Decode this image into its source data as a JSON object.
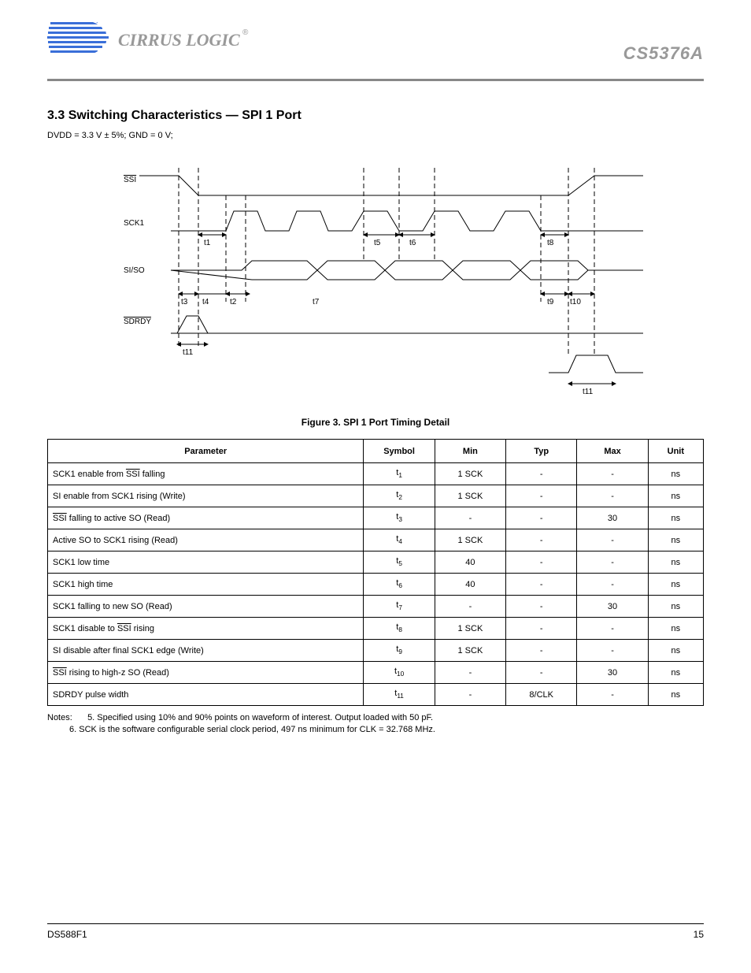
{
  "header": {
    "brand": "CIRRUS LOGIC",
    "part": "CS5376A"
  },
  "sections": {
    "switching": {
      "number_title": "3.3  Switching Characteristics — SPI 1 Port",
      "condition": "DVDD = 3.3 V ± 5%; GND = 0 V;",
      "fig_caption": "Figure 3.  SPI 1 Port Timing Detail"
    }
  },
  "diagram": {
    "signals": [
      "SSI",
      "SCK1",
      "SI/SO",
      "SDRDY"
    ],
    "timings": {
      "t1": "t1",
      "t2": "t2",
      "t3": "t3",
      "t4": "t4",
      "t5": "t5",
      "t6": "t6",
      "t7": "t7",
      "t8": "t8",
      "t9": "t9",
      "t10": "t10",
      "t11": "t11"
    }
  },
  "table": {
    "headers": [
      "Parameter",
      "Symbol",
      "Min",
      "Typ",
      "Max",
      "Unit"
    ],
    "rows": [
      {
        "p_html": "SCK1 enable from <span class='over'>SSI</span> falling",
        "sym": "t<sub>1</sub>",
        "min": "1 SCK",
        "typ": "-",
        "max": "-",
        "unit": "ns"
      },
      {
        "p_html": "SI enable from SCK1 rising (Write)",
        "sym": "t<sub>2</sub>",
        "min": "1 SCK",
        "typ": "-",
        "max": "-",
        "unit": "ns"
      },
      {
        "p_html": "<span class='over'>SSI</span> falling to active SO (Read)",
        "sym": "t<sub>3</sub>",
        "min": "-",
        "typ": "-",
        "max": "30",
        "unit": "ns"
      },
      {
        "p_html": "Active SO to SCK1 rising (Read)",
        "sym": "t<sub>4</sub>",
        "min": "1 SCK",
        "typ": "-",
        "max": "-",
        "unit": "ns"
      },
      {
        "p_html": "SCK1 low time",
        "sym": "t<sub>5</sub>",
        "min": "40",
        "typ": "-",
        "max": "-",
        "unit": "ns"
      },
      {
        "p_html": "SCK1 high time",
        "sym": "t<sub>6</sub>",
        "min": "40",
        "typ": "-",
        "max": "-",
        "unit": "ns"
      },
      {
        "p_html": "SCK1 falling to new SO (Read)",
        "sym": "t<sub>7</sub>",
        "min": "-",
        "typ": "-",
        "max": "30",
        "unit": "ns"
      },
      {
        "p_html": "SCK1 disable to <span class='over'>SSI</span> rising",
        "sym": "t<sub>8</sub>",
        "min": "1 SCK",
        "typ": "-",
        "max": "-",
        "unit": "ns"
      },
      {
        "p_html": "SI disable after final SCK1 edge (Write)",
        "sym": "t<sub>9</sub>",
        "min": "1 SCK",
        "typ": "-",
        "max": "-",
        "unit": "ns"
      },
      {
        "p_html": "<span class='over'>SSI</span> rising to high-z SO (Read)",
        "sym": "t<sub>10</sub>",
        "min": "-",
        "typ": "-",
        "max": "30",
        "unit": "ns"
      },
      {
        "p_html": "SDRDY pulse width",
        "sym": "t<sub>11</sub>",
        "min": "-",
        "typ": "8/CLK",
        "max": "-",
        "unit": "ns"
      }
    ]
  },
  "notes": {
    "label": "Notes:",
    "items": [
      "5. Specified using 10% and 90% points on waveform of interest. Output loaded with 50 pF.",
      "6. SCK is the software configurable serial clock period, 497 ns minimum for CLK = 32.768 MHz."
    ]
  },
  "footer": {
    "left": "DS588F1",
    "right": "15"
  }
}
